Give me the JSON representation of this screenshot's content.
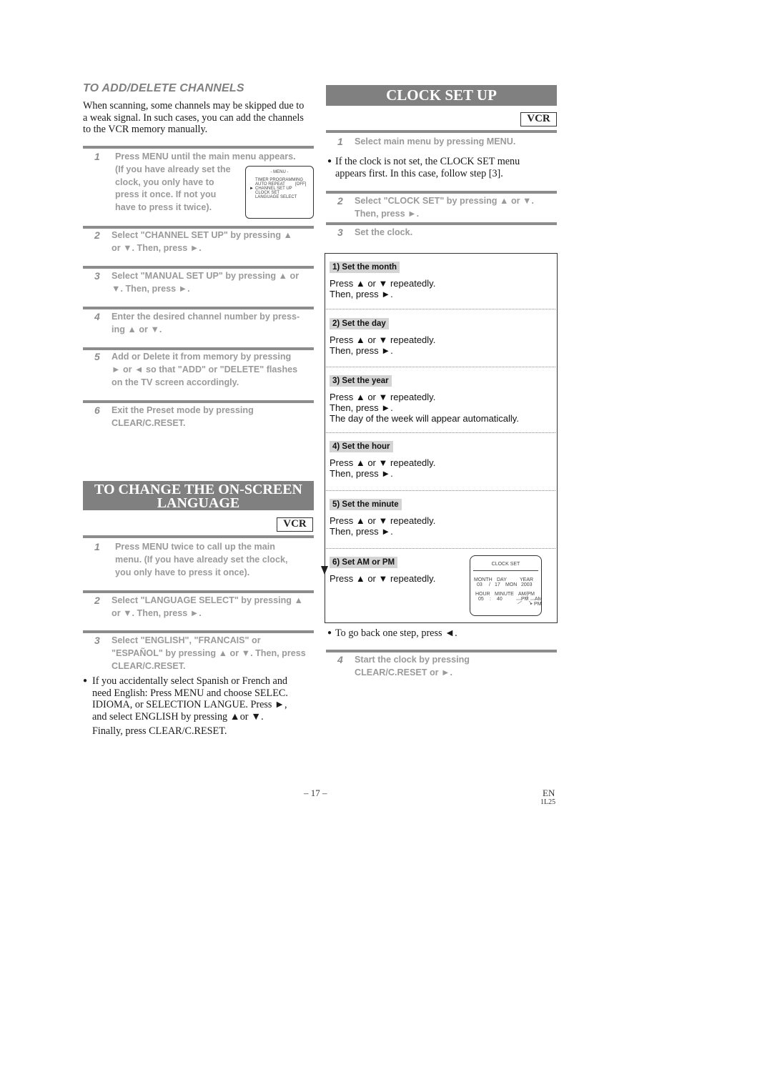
{
  "left": {
    "add_delete": {
      "heading": "TO ADD/DELETE CHANNELS",
      "intro": [
        "When scanning, some channels may be skipped due to",
        "a weak signal. In such cases, you can add  the channels",
        "to the VCR memory manually."
      ],
      "steps": [
        {
          "num": "1",
          "lines": [
            "Press MENU until the main menu appears.",
            "(If you have already set the",
            "clock, you only have to",
            "press it once.  If not you",
            "have to press it twice)."
          ]
        },
        {
          "num": "2",
          "lines": [
            "Select \"CHANNEL SET UP\" by pressing ▲",
            "or ▼. Then, press ►."
          ]
        },
        {
          "num": "3",
          "lines": [
            "Select \"MANUAL SET UP\" by pressing ▲ or",
            "▼. Then, press ►."
          ]
        },
        {
          "num": "4",
          "lines": [
            "Enter the desired channel number by press-",
            "ing ▲ or ▼."
          ]
        },
        {
          "num": "5",
          "lines": [
            "Add or Delete it from memory by pressing",
            "► or ◄ so that \"ADD\" or \"DELETE\" flashes",
            "on the TV screen accordingly."
          ]
        },
        {
          "num": "6",
          "lines": [
            "Exit the Preset mode by pressing",
            "CLEAR/C.RESET."
          ]
        }
      ],
      "menu_screen": {
        "title": "- MENU -",
        "items": [
          "TIMER PROGRAMMING",
          "AUTO REPEAT",
          "CHANNEL SET UP",
          "CLOCK SET",
          "LANGUAGE SELECT"
        ],
        "auto_repeat_value": "[OFF]",
        "cursor": "►",
        "selected_index": 2
      }
    },
    "language": {
      "banner": [
        "TO CHANGE THE ON-SCREEN",
        "LANGUAGE"
      ],
      "badge": "VCR",
      "steps": [
        {
          "num": "1",
          "lines": [
            "Press MENU twice to call up the main",
            "menu. (If you have already set the clock,",
            "you only have to press it once)."
          ]
        },
        {
          "num": "2",
          "lines": [
            "Select \"LANGUAGE SELECT\" by pressing ▲",
            "or ▼. Then, press ►."
          ]
        },
        {
          "num": "3",
          "lines": [
            "Select \"ENGLISH\", \"FRANCAIS\" or",
            "\"ESPAÑOL\" by pressing ▲ or ▼. Then, press",
            "CLEAR/C.RESET."
          ]
        }
      ],
      "note": {
        "bullet": "●",
        "lines": [
          "If you accidentally select Spanish or French and",
          "need English: Press MENU and choose SELEC.",
          "IDIOMA, or SELECTION LANGUE. Press ►,",
          "and select ENGLISH by pressing ▲or ▼."
        ],
        "final": "Finally, press CLEAR/C.RESET."
      }
    }
  },
  "right": {
    "banner": "CLOCK SET UP",
    "badge": "VCR",
    "step1": {
      "num": "1",
      "text": "Select main menu by pressing MENU."
    },
    "note1": {
      "bullet": "●",
      "lines": [
        "If  the  clock  is  not  set,  the  CLOCK  SET  menu",
        "appears first. In this case, follow step [3]."
      ]
    },
    "step2": {
      "num": "2",
      "lines": [
        "Select \"CLOCK SET\" by pressing ▲ or ▼.",
        "Then, press ►."
      ]
    },
    "step3": {
      "num": "3",
      "text": "Set the clock."
    },
    "substeps": [
      {
        "label": "1) Set the month",
        "lines": [
          "Press ▲ or ▼ repeatedly.",
          "Then, press ►."
        ]
      },
      {
        "label": "2) Set the day",
        "lines": [
          "Press ▲ or ▼ repeatedly.",
          "Then, press ►."
        ]
      },
      {
        "label": "3) Set the year",
        "lines": [
          "Press ▲ or ▼ repeatedly.",
          "Then, press ►.",
          "The day of the week will appear automatically."
        ]
      },
      {
        "label": "4) Set the hour",
        "lines": [
          "Press ▲ or ▼ repeatedly.",
          "Then, press ►."
        ]
      },
      {
        "label": "5) Set the minute",
        "lines": [
          "Press ▲ or ▼ repeatedly.",
          "Then, press ►."
        ]
      },
      {
        "label": "6) Set AM or PM",
        "lines": [
          "Press  ▲ or ▼ repeatedly."
        ]
      }
    ],
    "clock_osd": {
      "title": "CLOCK SET",
      "row1_labels": [
        "MONTH",
        "DAY",
        "YEAR"
      ],
      "month": "03",
      "sep1": "/",
      "day": "17",
      "weekday": "MON",
      "year": "2003",
      "row2_labels": [
        "HOUR",
        "MINUTE",
        "AM/PM"
      ],
      "hour": "05",
      "sep2": ":",
      "minute": "40",
      "ampm": "PM",
      "options": [
        "AM",
        "PM"
      ],
      "cursor": "►"
    },
    "note2": {
      "bullet": "●",
      "text": "To go back one step, press ◄."
    },
    "step4": {
      "num": "4",
      "lines": [
        "Start the clock by pressing",
        "CLEAR/C.RESET or ►."
      ]
    }
  },
  "footer": {
    "page_number": "– 17 –",
    "lang": "EN",
    "code": "1L25"
  }
}
